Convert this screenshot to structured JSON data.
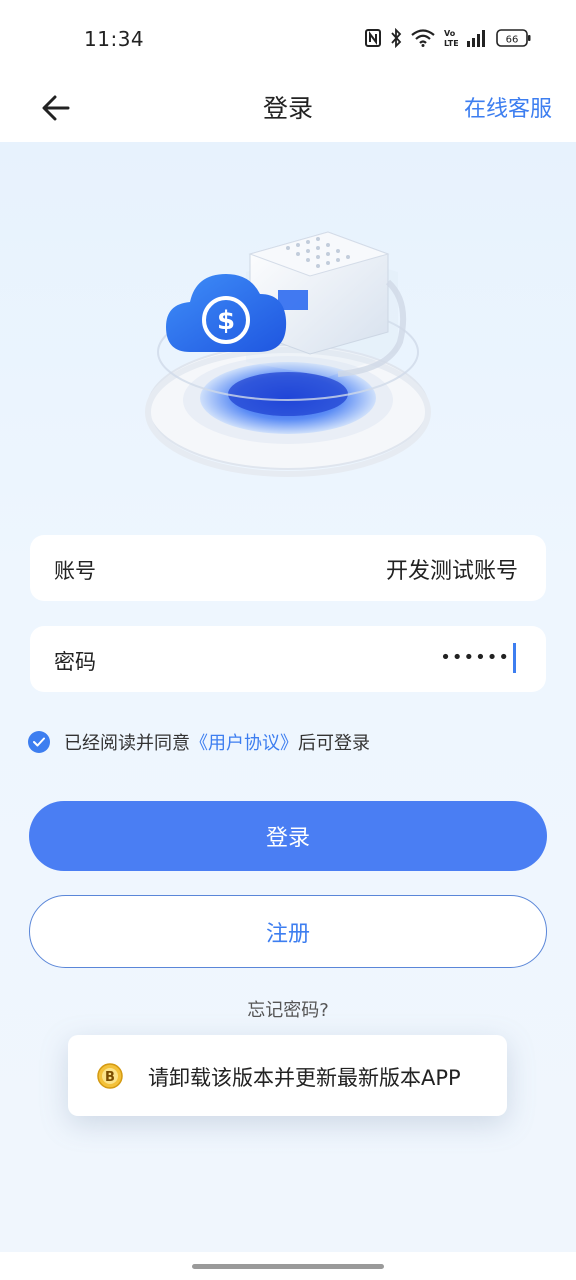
{
  "status_bar": {
    "time": "11:34",
    "icons": [
      "nfc-icon",
      "bluetooth-icon",
      "wifi-icon",
      "volte-icon",
      "signal-icon",
      "battery-icon"
    ],
    "battery": "66"
  },
  "nav": {
    "back_icon": "arrow-left-icon",
    "title": "登录",
    "service_link": "在线客服"
  },
  "hero": {
    "image": "cloud-server-illustration"
  },
  "form": {
    "account": {
      "label": "账号",
      "value": "开发测试账号"
    },
    "password": {
      "label": "密码",
      "value": "••••••"
    }
  },
  "agreement": {
    "checked": true,
    "prefix": "已经阅读并同意",
    "link": "《用户协议》",
    "suffix": "后可登录"
  },
  "buttons": {
    "login": "登录",
    "register": "注册"
  },
  "forgot": "忘记密码?",
  "toast": {
    "icon": "app-logo-icon",
    "text": "请卸载该版本并更新最新版本APP"
  },
  "colors": {
    "accent": "#4a7ef3",
    "link": "#3d7ef0",
    "background": "#eef6fe"
  }
}
